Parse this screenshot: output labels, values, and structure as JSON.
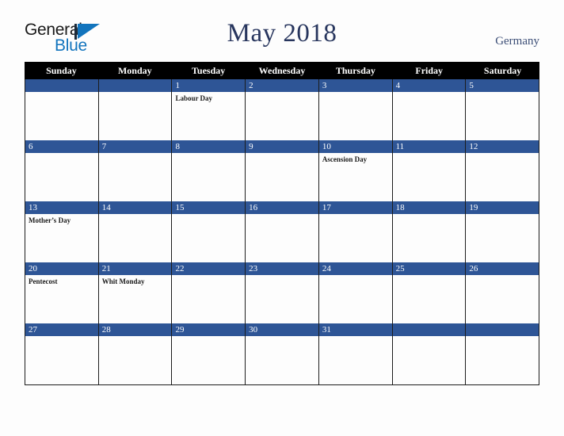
{
  "brand": {
    "line1": "General",
    "line2": "Blue"
  },
  "header": {
    "title": "May 2018",
    "country": "Germany"
  },
  "colors": {
    "day_banner": "#2e5596",
    "header_row": "#000000",
    "title_text": "#28365e",
    "brand_blue": "#1274bd",
    "background": "#fdfdfd"
  },
  "calendar": {
    "weekdays": [
      "Sunday",
      "Monday",
      "Tuesday",
      "Wednesday",
      "Thursday",
      "Friday",
      "Saturday"
    ],
    "weeks": [
      [
        {
          "day": "",
          "events": []
        },
        {
          "day": "",
          "events": []
        },
        {
          "day": "1",
          "events": [
            "Labour Day"
          ]
        },
        {
          "day": "2",
          "events": []
        },
        {
          "day": "3",
          "events": []
        },
        {
          "day": "4",
          "events": []
        },
        {
          "day": "5",
          "events": []
        }
      ],
      [
        {
          "day": "6",
          "events": []
        },
        {
          "day": "7",
          "events": []
        },
        {
          "day": "8",
          "events": []
        },
        {
          "day": "9",
          "events": []
        },
        {
          "day": "10",
          "events": [
            "Ascension Day"
          ]
        },
        {
          "day": "11",
          "events": []
        },
        {
          "day": "12",
          "events": []
        }
      ],
      [
        {
          "day": "13",
          "events": [
            "Mother’s Day"
          ]
        },
        {
          "day": "14",
          "events": []
        },
        {
          "day": "15",
          "events": []
        },
        {
          "day": "16",
          "events": []
        },
        {
          "day": "17",
          "events": []
        },
        {
          "day": "18",
          "events": []
        },
        {
          "day": "19",
          "events": []
        }
      ],
      [
        {
          "day": "20",
          "events": [
            "Pentecost"
          ]
        },
        {
          "day": "21",
          "events": [
            "Whit Monday"
          ]
        },
        {
          "day": "22",
          "events": []
        },
        {
          "day": "23",
          "events": []
        },
        {
          "day": "24",
          "events": []
        },
        {
          "day": "25",
          "events": []
        },
        {
          "day": "26",
          "events": []
        }
      ],
      [
        {
          "day": "27",
          "events": []
        },
        {
          "day": "28",
          "events": []
        },
        {
          "day": "29",
          "events": []
        },
        {
          "day": "30",
          "events": []
        },
        {
          "day": "31",
          "events": []
        },
        {
          "day": "",
          "events": []
        },
        {
          "day": "",
          "events": []
        }
      ]
    ]
  }
}
